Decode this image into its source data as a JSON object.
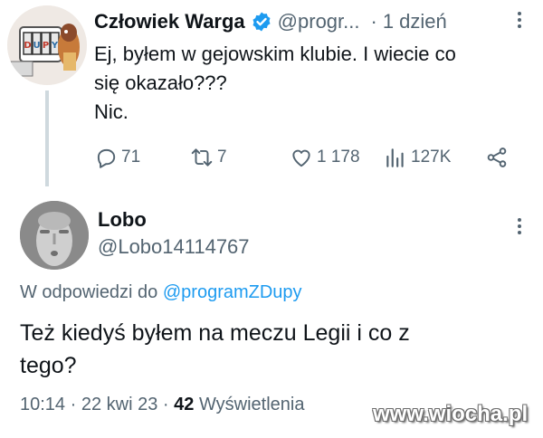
{
  "tweet": {
    "author_name": "Człowiek Warga",
    "handle": "@progr...",
    "separator": "·",
    "time": "1 dzień",
    "text_lines": [
      "Ej, byłem w gejowskim klubie. I wiecie co",
      "się okazało???",
      "Nic."
    ],
    "avatar_lettering": "DUPY",
    "stats": {
      "replies": "71",
      "retweets": "7",
      "likes": "1 178",
      "views": "127K"
    },
    "icons": {
      "verified": "verified-badge-icon",
      "more": "more-dots-icon",
      "reply": "reply-bubble-icon",
      "retweet": "retweet-icon",
      "like": "heart-icon",
      "views": "views-chart-icon",
      "share": "share-icon"
    }
  },
  "reply": {
    "author_name": "Lobo",
    "handle": "@Lobo14114767",
    "replying_prefix": "W odpowiedzi do",
    "replying_mention": "@programZDupy",
    "text_lines": [
      "Też kiedyś byłem na meczu Legii i co z",
      "tego?"
    ],
    "time": "10:14",
    "separator1": "·",
    "date": "22 kwi 23",
    "separator2": "·",
    "views_count": "42",
    "views_label": "Wyświetlenia"
  },
  "watermark": "www.wiocha.pl",
  "colors": {
    "text": "#0f1419",
    "secondary": "#536471",
    "accent": "#1d9bf0",
    "thread_line": "#cfd9de"
  }
}
